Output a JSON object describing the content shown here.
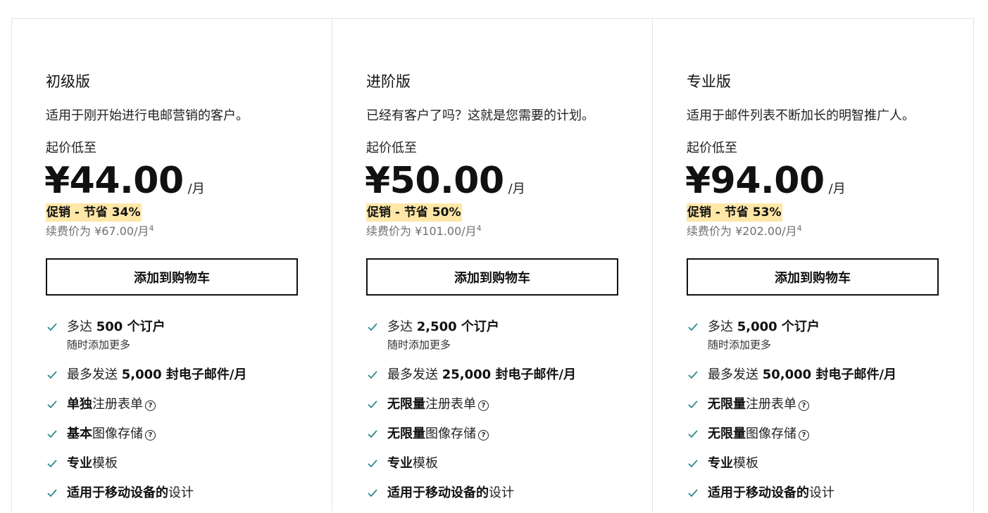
{
  "plans": [
    {
      "name": "初级版",
      "description": "适用于刚开始进行电邮营销的客户。",
      "starting_label": "起价低至",
      "price": "¥44.00",
      "per": "/月",
      "promo": "促销 - 节省 34%",
      "renewal": "续费价为 ¥67.00/月",
      "renewal_note": "4",
      "cart_label": "添加到购物车",
      "features": [
        {
          "prefix": "多达 ",
          "bold": "500 个订户",
          "suffix": "",
          "sub": "随时添加更多",
          "help": false
        },
        {
          "prefix": "最多发送 ",
          "bold": "5,000 封电子邮件/月",
          "suffix": "",
          "sub": "",
          "help": false
        },
        {
          "prefix": "",
          "bold": "单独",
          "suffix": "注册表单",
          "sub": "",
          "help": true
        },
        {
          "prefix": "",
          "bold": "基本",
          "suffix": "图像存储",
          "sub": "",
          "help": true
        },
        {
          "prefix": "",
          "bold": "专业",
          "suffix": "模板",
          "sub": "",
          "help": false
        },
        {
          "prefix": "",
          "bold": "适用于移动设备的",
          "suffix": "设计",
          "sub": "",
          "help": false
        }
      ]
    },
    {
      "name": "进阶版",
      "description": "已经有客户了吗？这就是您需要的计划。",
      "starting_label": "起价低至",
      "price": "¥50.00",
      "per": "/月",
      "promo": "促销 - 节省 50%",
      "renewal": "续费价为 ¥101.00/月",
      "renewal_note": "4",
      "cart_label": "添加到购物车",
      "features": [
        {
          "prefix": "多达 ",
          "bold": "2,500 个订户",
          "suffix": "",
          "sub": "随时添加更多",
          "help": false
        },
        {
          "prefix": "最多发送 ",
          "bold": "25,000 封电子邮件/月",
          "suffix": "",
          "sub": "",
          "help": false
        },
        {
          "prefix": "",
          "bold": "无限量",
          "suffix": "注册表单",
          "sub": "",
          "help": true
        },
        {
          "prefix": "",
          "bold": "无限量",
          "suffix": "图像存储",
          "sub": "",
          "help": true
        },
        {
          "prefix": "",
          "bold": "专业",
          "suffix": "模板",
          "sub": "",
          "help": false
        },
        {
          "prefix": "",
          "bold": "适用于移动设备的",
          "suffix": "设计",
          "sub": "",
          "help": false
        }
      ]
    },
    {
      "name": "专业版",
      "description": "适用于邮件列表不断加长的明智推广人。",
      "starting_label": "起价低至",
      "price": "¥94.00",
      "per": "/月",
      "promo": "促销 - 节省 53%",
      "renewal": "续费价为 ¥202.00/月",
      "renewal_note": "4",
      "cart_label": "添加到购物车",
      "features": [
        {
          "prefix": "多达 ",
          "bold": "5,000 个订户",
          "suffix": "",
          "sub": "随时添加更多",
          "help": false
        },
        {
          "prefix": "最多发送 ",
          "bold": "50,000 封电子邮件/月",
          "suffix": "",
          "sub": "",
          "help": false
        },
        {
          "prefix": "",
          "bold": "无限量",
          "suffix": "注册表单",
          "sub": "",
          "help": true
        },
        {
          "prefix": "",
          "bold": "无限量",
          "suffix": "图像存储",
          "sub": "",
          "help": true
        },
        {
          "prefix": "",
          "bold": "专业",
          "suffix": "模板",
          "sub": "",
          "help": false
        },
        {
          "prefix": "",
          "bold": "适用于移动设备的",
          "suffix": "设计",
          "sub": "",
          "help": false
        }
      ]
    }
  ],
  "help_glyph": "?",
  "icons": {
    "check": "check-icon",
    "help": "help-circle-icon"
  },
  "colors": {
    "check": "#2d8a8a",
    "promo_highlight": "#ffe7a8",
    "border": "#e3e3e3"
  }
}
